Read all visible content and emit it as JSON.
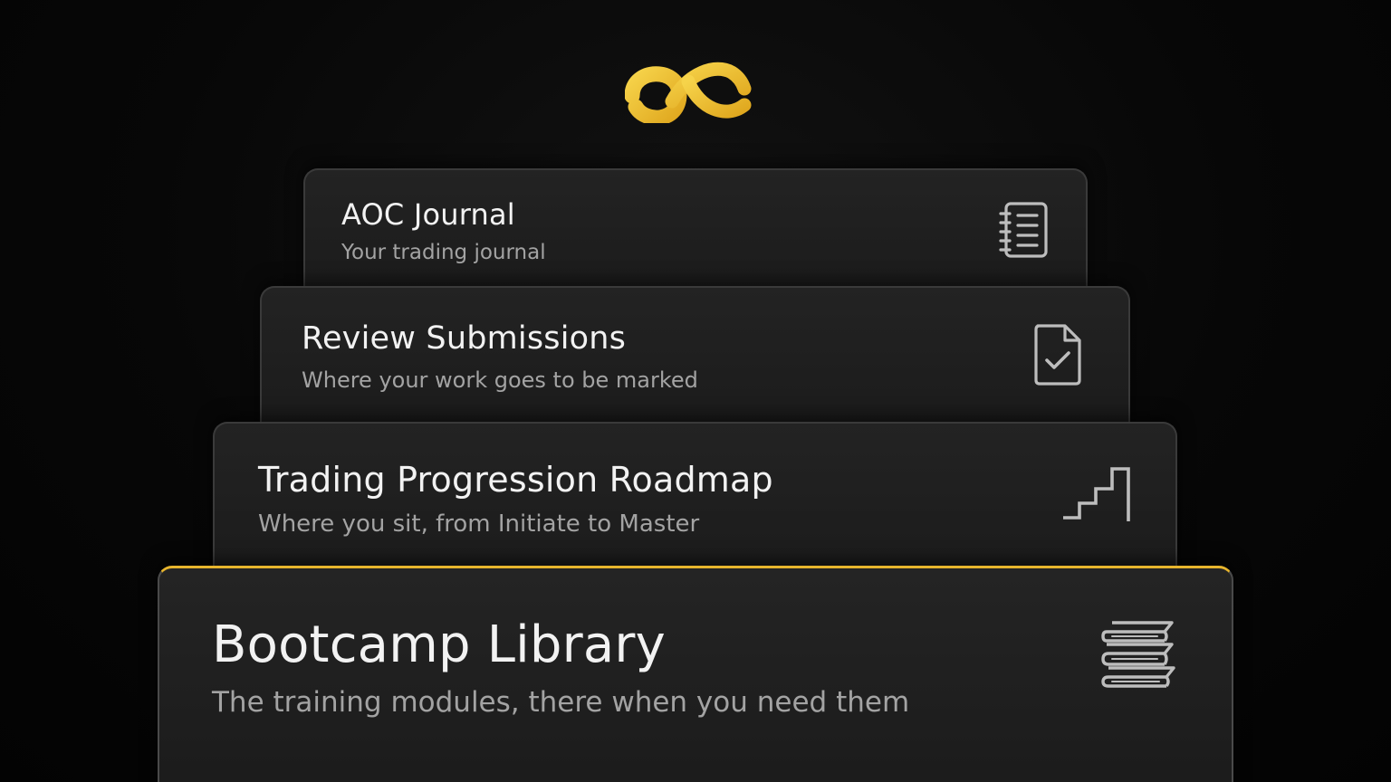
{
  "brand": {
    "logo_icon": "bc-logo-icon",
    "accent_color": "#E7B52D"
  },
  "cards": [
    {
      "title": "AOC Journal",
      "subtitle": "Your trading journal",
      "icon": "notebook-icon"
    },
    {
      "title": "Review Submissions",
      "subtitle": "Where your work goes to be marked",
      "icon": "document-check-icon"
    },
    {
      "title": "Trading Progression Roadmap",
      "subtitle": "Where you sit, from Initiate to Master",
      "icon": "stairs-icon"
    },
    {
      "title": "Bootcamp Library",
      "subtitle": "The training modules, there when you need them",
      "icon": "books-icon",
      "highlighted": true
    }
  ]
}
